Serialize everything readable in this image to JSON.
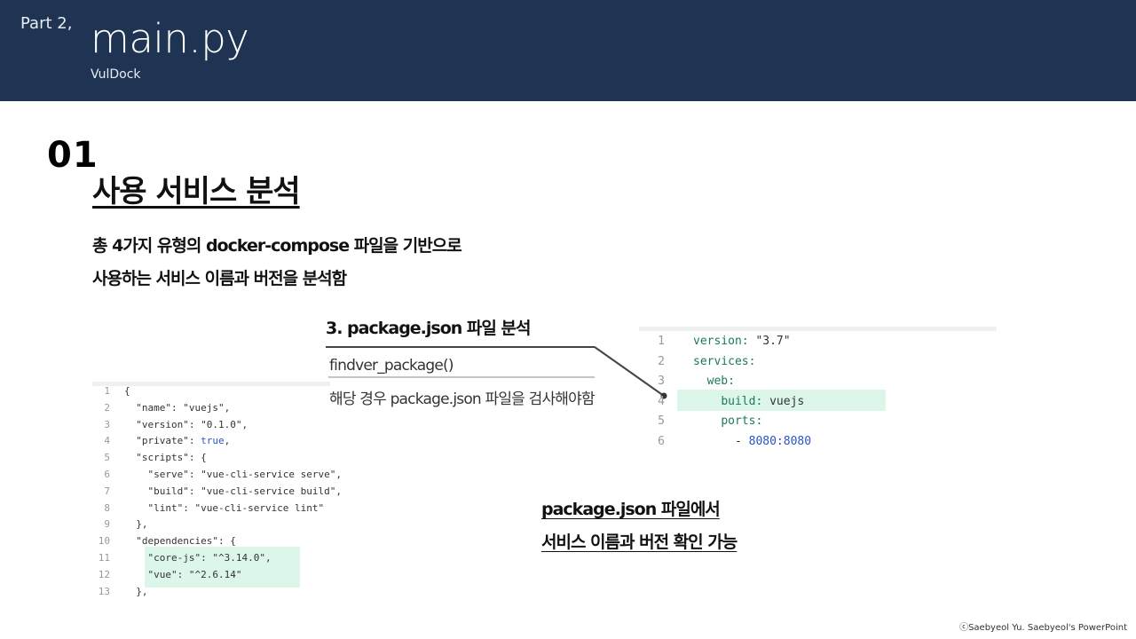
{
  "header": {
    "part": "Part 2,",
    "title": "main.py",
    "subtitle": "VulDock"
  },
  "section": {
    "number": "01",
    "title": "사용 서비스 분석"
  },
  "description": {
    "line1": "총 4가지 유형의 docker-compose 파일을 기반으로",
    "line2": "사용하는 서비스 이름과 버전을 분석함"
  },
  "step": {
    "label": "3. package.json 파일 분석",
    "function": "findver_package()",
    "note": "해당 경우 package.json 파일을 검사해야함"
  },
  "conclusion": {
    "line1": "package.json 파일에서",
    "line2": "서비스 이름과 버전 확인 가능"
  },
  "package_json": {
    "lines": [
      {
        "n": "1",
        "t": "{"
      },
      {
        "n": "2",
        "t": "  \"name\": \"vuejs\","
      },
      {
        "n": "3",
        "t": "  \"version\": \"0.1.0\","
      },
      {
        "n": "4",
        "t": "  \"private\": true,"
      },
      {
        "n": "5",
        "t": "  \"scripts\": {"
      },
      {
        "n": "6",
        "t": "    \"serve\": \"vue-cli-service serve\","
      },
      {
        "n": "7",
        "t": "    \"build\": \"vue-cli-service build\","
      },
      {
        "n": "8",
        "t": "    \"lint\": \"vue-cli-service lint\""
      },
      {
        "n": "9",
        "t": "  },"
      },
      {
        "n": "10",
        "t": "  \"dependencies\": {"
      },
      {
        "n": "11",
        "t": "    \"core-js\": \"^3.14.0\","
      },
      {
        "n": "12",
        "t": "    \"vue\": \"^2.6.14\""
      },
      {
        "n": "13",
        "t": "  },"
      }
    ]
  },
  "compose": {
    "lines": [
      {
        "n": "1",
        "t": "version: \"3.7\""
      },
      {
        "n": "2",
        "t": "services:"
      },
      {
        "n": "3",
        "t": "  web:"
      },
      {
        "n": "4",
        "t": "    build: vuejs"
      },
      {
        "n": "5",
        "t": "    ports:"
      },
      {
        "n": "6",
        "t": "      - 8080:8080"
      }
    ]
  },
  "footer": {
    "copyright": "ⓒSaebyeol Yu. Saebyeol's PowerPoint"
  }
}
